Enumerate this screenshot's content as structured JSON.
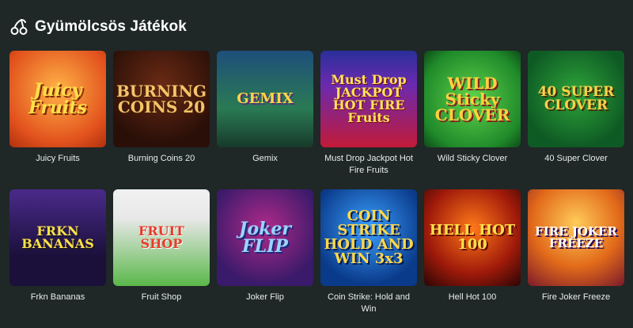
{
  "section": {
    "title": "Gyümölcsös Játékok",
    "icon": "cherries-icon"
  },
  "games": [
    {
      "name": "Juicy Fruits",
      "thumb_text": "Juicy Fruits",
      "theme": "juicy"
    },
    {
      "name": "Burning Coins 20",
      "thumb_text": "BURNING COINS 20",
      "theme": "burning"
    },
    {
      "name": "Gemix",
      "thumb_text": "GEMIX",
      "theme": "gemix"
    },
    {
      "name": "Must Drop Jackpot Hot Fire Fruits",
      "thumb_text": "Must Drop JACKPOT HOT FIRE Fruits",
      "theme": "mustdrop"
    },
    {
      "name": "Wild Sticky Clover",
      "thumb_text": "WILD Sticky CLOVER",
      "theme": "wild"
    },
    {
      "name": "40 Super Clover",
      "thumb_text": "40 SUPER CLOVER",
      "theme": "40"
    },
    {
      "name": "Frkn Bananas",
      "thumb_text": "FRKN BANANAS",
      "theme": "frkn"
    },
    {
      "name": "Fruit Shop",
      "thumb_text": "FRUIT SHOP",
      "theme": "shop"
    },
    {
      "name": "Joker Flip",
      "thumb_text": "Joker FLIP",
      "theme": "joker"
    },
    {
      "name": "Coin Strike: Hold and Win",
      "thumb_text": "COIN STRIKE HOLD AND WIN 3x3",
      "theme": "coin"
    },
    {
      "name": "Hell Hot 100",
      "thumb_text": "HELL HOT 100",
      "theme": "hell"
    },
    {
      "name": "Fire Joker Freeze",
      "thumb_text": "FIRE JOKER FREEZE",
      "theme": "fire"
    }
  ],
  "colors": {
    "background": "#1f2727",
    "text": "#ffffff"
  }
}
